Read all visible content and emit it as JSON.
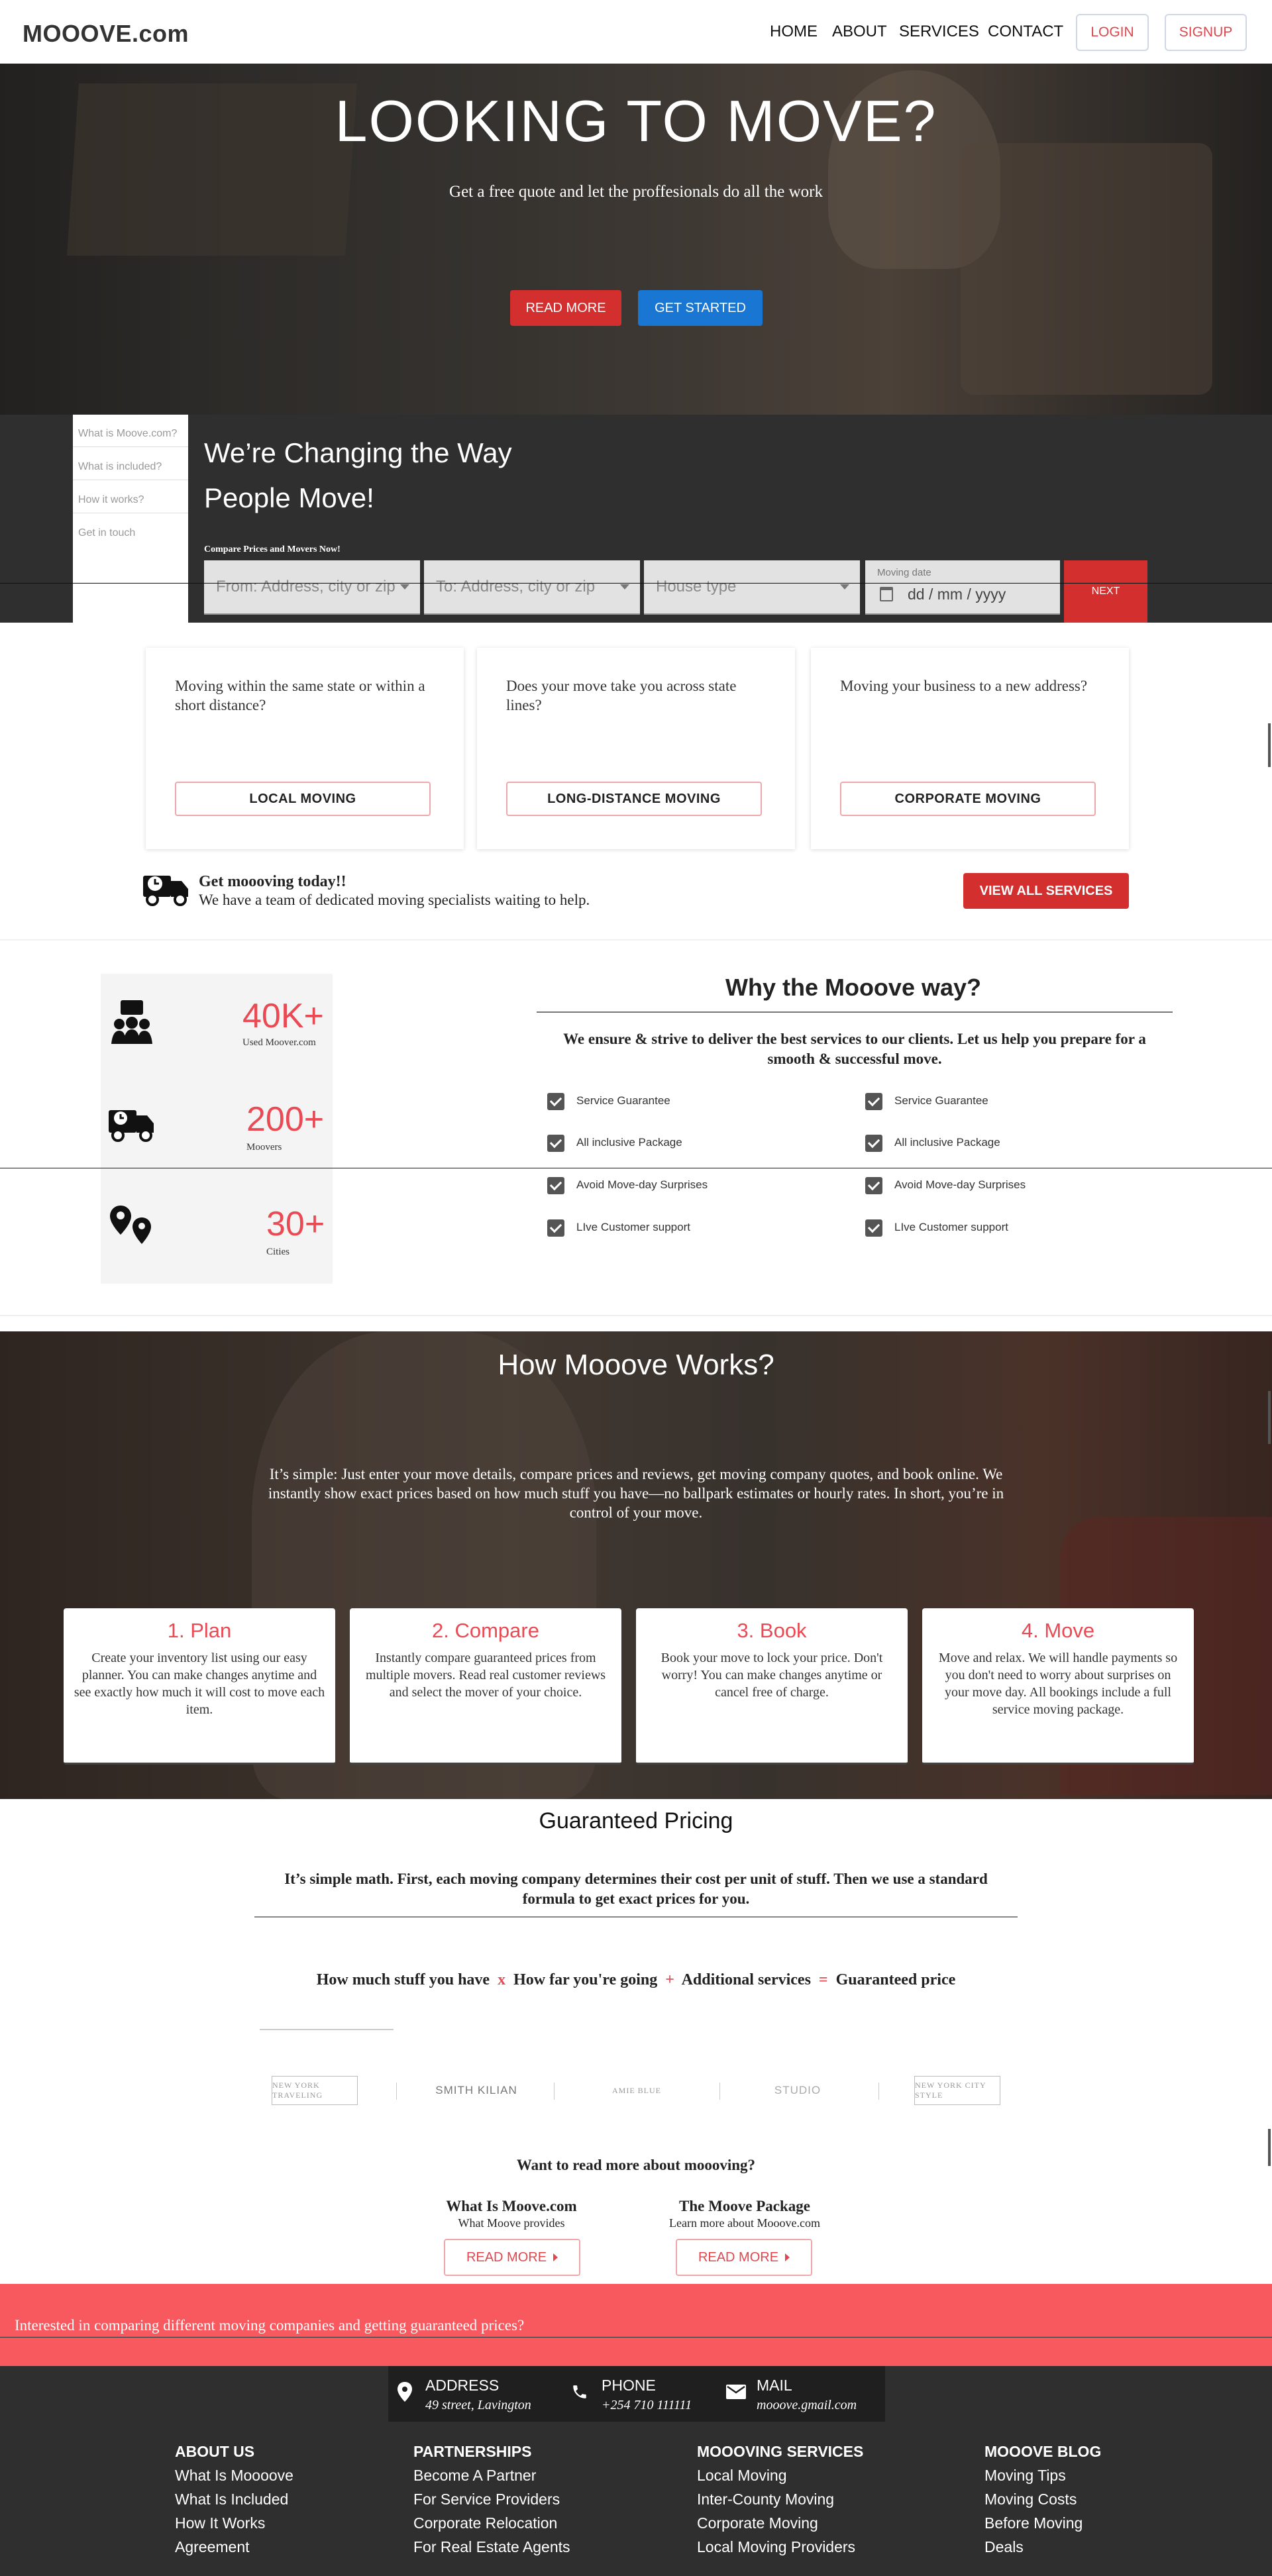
{
  "header": {
    "logo": "MOOOVE.com",
    "nav": [
      "HOME",
      "ABOUT",
      "SERVICES",
      "CONTACT"
    ],
    "login": "LOGIN",
    "signup": "SIGNUP"
  },
  "hero": {
    "title": "LOOKING TO MOVE?",
    "subtitle": "Get a free quote and let the proffesionals do all the work",
    "read_more": "READ MORE",
    "get_started": "GET STARTED"
  },
  "side_menu": [
    "What is Moove.com?",
    "What is included?",
    "How it works?",
    "Get in touch"
  ],
  "band": {
    "title_line1": "We’re Changing the Way",
    "title_line2": "People Move!",
    "compare_label": "Compare Prices and Movers Now!",
    "from_placeholder": "From: Address, city or zip",
    "to_placeholder": "To: Address, city or zip",
    "house_placeholder": "House type",
    "date_label": "Moving date",
    "date_placeholder": "dd / mm / yyyy",
    "next": "NEXT"
  },
  "services": [
    {
      "text": "Moving within the same state or within a short distance?",
      "button": "LOCAL MOVING"
    },
    {
      "text": "Does your move take you across state lines?",
      "button": "LONG-DISTANCE MOVING"
    },
    {
      "text": "Moving your business to a new address?",
      "button": "CORPORATE MOVING"
    }
  ],
  "get_mooving": {
    "title": "Get moooving today!!",
    "subtitle": "We have a team of dedicated moving specialists waiting to help.",
    "button": "VIEW ALL SERVICES"
  },
  "stats": [
    {
      "value": "40K+",
      "label": "Used Moover.com",
      "icon": "users-icon"
    },
    {
      "value": "200+",
      "label": "Moovers",
      "icon": "truck-icon"
    },
    {
      "value": "30+",
      "label": "Cities",
      "icon": "location-pins-icon"
    }
  ],
  "why": {
    "title": "Why the Mooove way?",
    "subtitle": "We ensure & strive to deliver the best services to our clients. Let us help you prepare for a smooth & successful move.",
    "left": [
      "Service Guarantee",
      "All inclusive Package",
      "Avoid Move-day Surprises",
      "LIve Customer support"
    ],
    "right": [
      "Service Guarantee",
      "All inclusive Package",
      "Avoid Move-day Surprises",
      "LIve Customer support"
    ]
  },
  "how": {
    "title": "How Mooove Works?",
    "description": "It’s simple: Just enter your move details, compare prices and reviews, get moving company quotes, and book online. We instantly show exact prices based on how much stuff you have—no ballpark estimates or hourly rates. In short, you’re in control of your move.",
    "steps": [
      {
        "title": "1. Plan",
        "desc": "Create your inventory list using our easy planner. You can make changes anytime and see exactly how much it will cost to move each item."
      },
      {
        "title": "2. Compare",
        "desc": "Instantly compare guaranteed prices from multiple movers. Read real customer reviews and select the mover of your choice."
      },
      {
        "title": "3. Book",
        "desc": "Book your move to lock your price. Don't worry! You can make changes anytime or cancel free of charge."
      },
      {
        "title": "4. Move",
        "desc": "Move and relax. We will handle payments so you don't need to worry about surprises on your move day. All bookings include a full service moving package."
      }
    ]
  },
  "pricing": {
    "title": "Guaranteed Pricing",
    "description": "It’s simple math. First, each moving company determines their cost per unit of stuff. Then we use a standard formula to get exact prices for you.",
    "formula": {
      "a": "How much stuff you have",
      "op1": "x",
      "b": "How far you're going",
      "op2": "+",
      "c": "Additional services",
      "op3": "=",
      "d": "Guaranteed price"
    }
  },
  "logos": [
    "NEW YORK TRAVELING",
    "SMITH KILIAN",
    "AMIE BLUE",
    "STUDIO",
    "NEW YORK CITY STYLE"
  ],
  "read_more_section": {
    "question": "Want to read more about moooving?",
    "items": [
      {
        "title": "What Is Moove.com",
        "subtitle": "What Moove provides",
        "button": "READ MORE"
      },
      {
        "title": "The Moove Package",
        "subtitle": "Learn more about Mooove.com",
        "button": "READ MORE"
      }
    ]
  },
  "banner": "Interested in comparing different moving companies and getting guaranteed prices?",
  "contact": {
    "address_label": "ADDRESS",
    "address": "49 street, Lavington",
    "phone_label": "PHONE",
    "phone": "+254 710 111111",
    "mail_label": "MAIL",
    "mail": "mooove.gmail.com"
  },
  "footer": [
    {
      "head": "ABOUT US",
      "links": [
        "What Is Moooove",
        "What Is Included",
        "How It Works",
        "Agreement"
      ]
    },
    {
      "head": "PARTNERSHIPS",
      "links": [
        "Become A Partner",
        "For Service Providers",
        "Corporate Relocation",
        "For Real Estate Agents"
      ]
    },
    {
      "head": "MOOOVING SERVICES",
      "links": [
        "Local Moving",
        "Inter-County Moving",
        "Corporate Moving",
        "Local Moving Providers"
      ]
    },
    {
      "head": "MOOOVE BLOG",
      "links": [
        "Moving Tips",
        "Moving Costs",
        "Before Moving",
        "Deals"
      ]
    }
  ],
  "colors": {
    "accent": "#ea4a54",
    "blue": "#1976d2",
    "red_button": "#d32f2f",
    "dark": "#2f2f30",
    "banner": "#f8595f"
  }
}
